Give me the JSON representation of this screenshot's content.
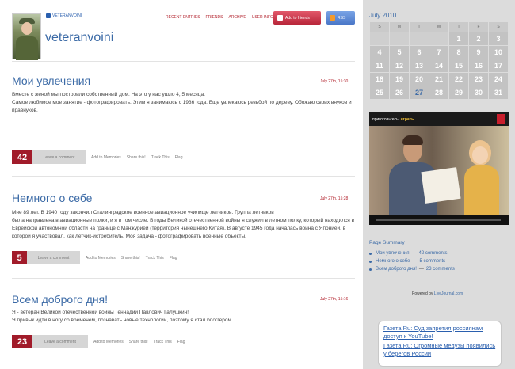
{
  "header": {
    "user_link": "VETERANVOINI",
    "username": "veteranvoini",
    "nav": [
      "RECENT ENTRIES",
      "FRIENDS",
      "ARCHIVE",
      "USER INFO"
    ],
    "add_friends": "Add to friends",
    "rss": "RSS"
  },
  "posts": [
    {
      "title": "Мои увлечения",
      "date": "July 27th, 15:30",
      "body": "Вместе с женой мы построили собственный дом. На это у нас ушло 4, 5 месяца.\nСамое любимое мое занятие - фотографировать. Этим я занимаюсь с 1936 года. Еще увлекаюсь резьбой по дереву. Обожаю своих внуков и правнуков.",
      "comments": "42"
    },
    {
      "title": "Немного о себе",
      "date": "July 27th, 15:28",
      "body": "Мне 89 лет. В 1940 году закончил Сталинградское военное авиационное училище летчиков. Группа летчиков\nбыла направлена в авиационные полки, и я в том числе. В годы Великой отечественной войны я служил в летном полку, который находился в Еврейской автономной области на границе с Манжурией (территория нынешнего Китая). В августе 1945 года началась война с Японией, в которой я участвовал, как летчик-истребитель. Моя задача - фотографировать военные объекты.",
      "comments": "5"
    },
    {
      "title": "Всем доброго дня!",
      "date": "July 27th, 15:16",
      "body": "Я - ветеран Великой отечественной войны Геннадий Павлович Галушкин!\nЯ привык идти в ногу со временем, познавать новые технологии, поэтому я стал блоггером",
      "comments": "23"
    }
  ],
  "post_actions": {
    "leave": "Leave a comment",
    "memories": "Add to Memories",
    "share": "Share this!",
    "track": "Track This",
    "flag": "Flag"
  },
  "calendar": {
    "title": "July 2010",
    "weekdays": [
      "S",
      "M",
      "T",
      "W",
      "T",
      "F",
      "S"
    ],
    "weeks": [
      [
        "",
        "",
        "",
        "",
        "1",
        "2",
        "3"
      ],
      [
        "4",
        "5",
        "6",
        "7",
        "8",
        "9",
        "10"
      ],
      [
        "11",
        "12",
        "13",
        "14",
        "15",
        "16",
        "17"
      ],
      [
        "18",
        "19",
        "20",
        "21",
        "22",
        "23",
        "24"
      ],
      [
        "25",
        "26",
        "27",
        "28",
        "29",
        "30",
        "31"
      ]
    ],
    "today": "27"
  },
  "video": {
    "prepare": "приготовьтесь",
    "play": "играть"
  },
  "page_summary": {
    "title": "Page Summary",
    "items": [
      {
        "title": "Мои увлечения",
        "comments": "42 comments"
      },
      {
        "title": "Немного о себе",
        "comments": "5 comments"
      },
      {
        "title": "Всем доброго дня!",
        "comments": "23 comments"
      }
    ],
    "powered_prefix": "Powered by",
    "powered_link": "LiveJournal.com"
  },
  "news": [
    "Газета.Ru: Суд запретил россиянам доступ к YouTube!",
    "Газета.Ru: Огромные медузы появились у берегов России"
  ],
  "colors": {
    "accent_red": "#a11b2a",
    "link_blue": "#3b6aa6",
    "sidebar_bg": "#dcdcdc"
  }
}
